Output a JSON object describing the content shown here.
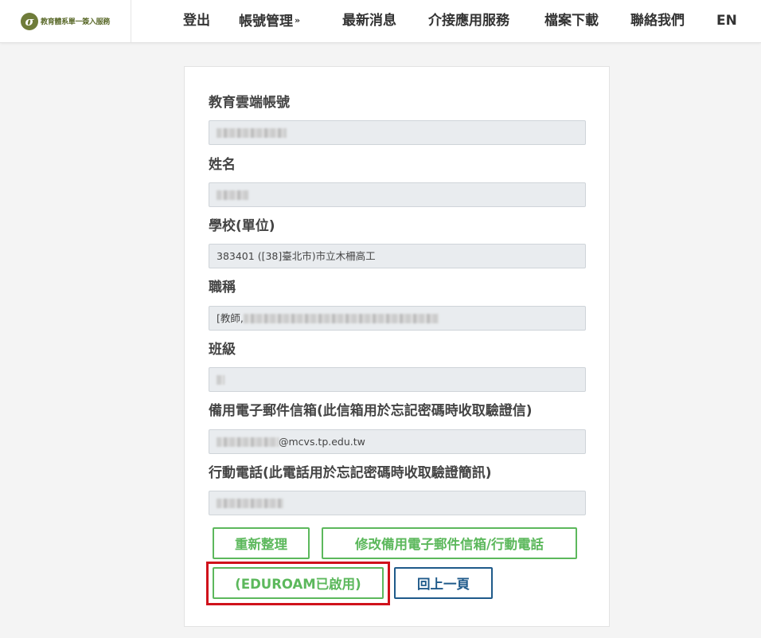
{
  "header": {
    "logo_text": "教育體系單一簽入服務",
    "nav": {
      "logout": "登出",
      "account_mgmt": "帳號管理",
      "news": "最新消息",
      "app_services": "介接應用服務",
      "downloads": "檔案下載",
      "contact": "聯絡我們",
      "language": "EN"
    }
  },
  "form": {
    "account_label": "教育雲端帳號",
    "name_label": "姓名",
    "school_label": "學校(單位)",
    "school_value": "383401 ([38]臺北市)市立木柵高工",
    "title_label": "職稱",
    "title_value_prefix": "[教師,",
    "class_label": "班級",
    "email_label": "備用電子郵件信箱(此信箱用於忘記密碼時收取驗證信)",
    "email_value_suffix": "@mcvs.tp.edu.tw",
    "phone_label": "行動電話(此電話用於忘記密碼時收取驗證簡訊)"
  },
  "buttons": {
    "reset": "重新整理",
    "edit_contact": "修改備用電子郵件信箱/行動電話",
    "eduroam": "(EDUROAM已啟用)",
    "back": "回上一頁"
  },
  "colors": {
    "green": "#5cb85c",
    "blue": "#1f5a8a",
    "highlight": "#d0121b"
  }
}
